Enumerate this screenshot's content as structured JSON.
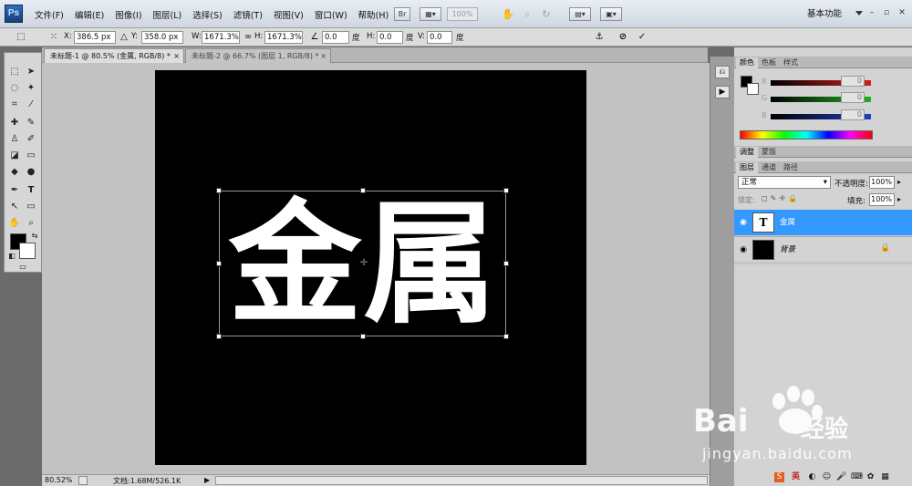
{
  "app": {
    "logo": "Ps",
    "workspace": "基本功能"
  },
  "menubar": {
    "items": [
      "文件(F)",
      "编辑(E)",
      "图像(I)",
      "图层(L)",
      "选择(S)",
      "滤镜(T)",
      "视图(V)",
      "窗口(W)",
      "帮助(H)"
    ],
    "zoom": "100%"
  },
  "options": {
    "x_label": "X:",
    "x_value": "386.5 px",
    "y_label": "Y:",
    "y_value": "358.0 px",
    "w_label": "W:",
    "w_value": "1671.3%",
    "h_label": "H:",
    "h_value": "1671.3%",
    "angle_value": "0.0",
    "angle_unit": "度",
    "hskew_label": "H:",
    "hskew_value": "0.0",
    "hskew_unit": "度",
    "vskew_label": "V:",
    "vskew_value": "0.0",
    "vskew_unit": "度"
  },
  "tabs": [
    {
      "label": "未标题-1 @ 80.5% (金属, RGB/8) *",
      "close": "×"
    },
    {
      "label": "未标题-2 @ 66.7% (图层 1, RGB/8) *",
      "close": "×"
    }
  ],
  "canvas": {
    "text": "金属"
  },
  "status": {
    "zoom": "80.52%",
    "doc": "文档:1.68M/526.1K"
  },
  "color_panel": {
    "tabs": [
      "颜色",
      "色板",
      "样式"
    ],
    "sliders": [
      {
        "label": "R",
        "value": "0",
        "color": "#d02020"
      },
      {
        "label": "G",
        "value": "0",
        "color": "#20b020"
      },
      {
        "label": "B",
        "value": "0",
        "color": "#2040c0"
      }
    ]
  },
  "adjust_panel": {
    "tabs": [
      "调整",
      "蒙版"
    ]
  },
  "layers_panel": {
    "tabs": [
      "图层",
      "通道",
      "路径"
    ],
    "blend_mode": "正常",
    "opacity_label": "不透明度:",
    "opacity_value": "100%",
    "lock_label": "锁定:",
    "fill_label": "填充:",
    "fill_value": "100%",
    "layers": [
      {
        "name": "金属",
        "type": "text",
        "selected": true
      },
      {
        "name": "背景",
        "type": "fill",
        "selected": false
      }
    ]
  },
  "watermark": {
    "brand": "Bai",
    "brand_cn": "经验",
    "url": "jingyan.baidu.com"
  },
  "taskbar": {
    "ime": "英"
  }
}
